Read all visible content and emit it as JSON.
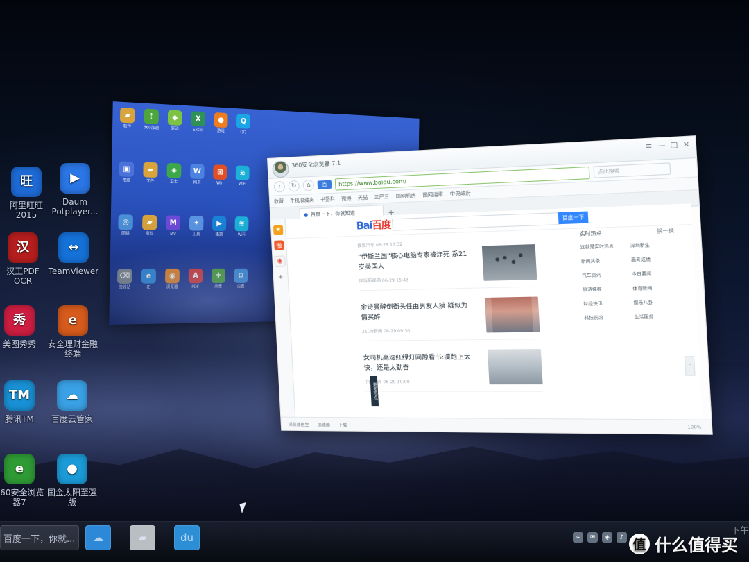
{
  "desktop": {
    "icons": [
      {
        "label": "阿里旺旺2015",
        "icon": "aliwangwang-icon",
        "color": "#1e6bd7"
      },
      {
        "label": "Daum Potplayer...",
        "icon": "play-icon",
        "color": "#2a76e6"
      },
      {
        "label": "汉王PDF OCR",
        "icon": "pdf-ocr-icon",
        "color": "#b71e1e"
      },
      {
        "label": "TeamViewer",
        "icon": "teamviewer-icon",
        "color": "#1572d9"
      },
      {
        "label": "美图秀秀",
        "icon": "meitu-icon",
        "color": "#cf1e42"
      },
      {
        "label": "安全理财金融终端",
        "icon": "finance-terminal-icon",
        "color": "#d75b1c"
      },
      {
        "label": "腾讯TM",
        "icon": "tencent-tm-icon",
        "color": "#1991d6"
      },
      {
        "label": "百度云管家",
        "icon": "baidu-cloud-icon",
        "color": "#3aa1e6"
      },
      {
        "label": "360安全浏览器7",
        "icon": "browser-icon",
        "color": "#2f9b35"
      },
      {
        "label": "国金太阳至强版",
        "icon": "sun-trade-icon",
        "color": "#1b9bd7"
      }
    ],
    "cursor": "mouse-cursor-icon"
  },
  "preview_window": {
    "mini_icons": [
      {
        "label": "软件",
        "icon": "folder-icon",
        "color": "#d9a43b"
      },
      {
        "label": "360加速",
        "icon": "speed-icon",
        "color": "#4da53c"
      },
      {
        "label": "驱动",
        "icon": "driver-icon",
        "color": "#7dc243"
      },
      {
        "label": "Excel",
        "icon": "excel-icon",
        "color": "#2f9155"
      },
      {
        "label": "游戏",
        "icon": "game-icon",
        "color": "#ef7c1f"
      },
      {
        "label": "QQ",
        "icon": "qq-icon",
        "color": "#1aa6e6"
      },
      {
        "label": "电脑",
        "icon": "computer-icon",
        "color": "#4a72d9"
      },
      {
        "label": "文件",
        "icon": "folder-icon",
        "color": "#d9a43b"
      },
      {
        "label": "卫士",
        "icon": "shield-icon",
        "color": "#3ca84a"
      },
      {
        "label": "网页",
        "icon": "web-icon",
        "color": "#4c82e0"
      },
      {
        "label": "Win",
        "icon": "windows-icon",
        "color": "#e34f25"
      },
      {
        "label": "WiFi",
        "icon": "wifi-icon",
        "color": "#1cb1d9"
      },
      {
        "label": "网络",
        "icon": "network-icon",
        "color": "#4b90d7"
      },
      {
        "label": "资料",
        "icon": "folder-icon",
        "color": "#d9a43b"
      },
      {
        "label": "MV",
        "icon": "video-icon",
        "color": "#6d4bd9"
      },
      {
        "label": "工具",
        "icon": "tool-icon",
        "color": "#5a95e3"
      },
      {
        "label": "播放",
        "icon": "play-icon",
        "color": "#1982d8"
      },
      {
        "label": "WiFi",
        "icon": "wifi-icon",
        "color": "#1cb1d9"
      },
      {
        "label": "回收站",
        "icon": "recycle-icon",
        "color": "#7f8c96"
      },
      {
        "label": "IE",
        "icon": "ie-icon",
        "color": "#2e8cde"
      },
      {
        "label": "浏览器",
        "icon": "browser-icon",
        "color": "#e6892a"
      },
      {
        "label": "PDF",
        "icon": "pdf-icon",
        "color": "#d93b3b"
      },
      {
        "label": "杀毒",
        "icon": "antivirus-icon",
        "color": "#4da53c"
      },
      {
        "label": "设置",
        "icon": "settings-icon",
        "color": "#3d92df"
      }
    ]
  },
  "browser": {
    "title": "360安全浏览器 7.1",
    "url": "https://www.baidu.com/",
    "search_placeholder": "点此搜索",
    "bookmarks": [
      "收藏",
      "手机收藏夹",
      "书签栏",
      "微博",
      "天猫",
      "三严三",
      "国网机房",
      "国网运维",
      "中央政府"
    ],
    "tab_label": "百度一下，你就知道",
    "logo_primary": "Bai",
    "logo_secondary": "百度",
    "search_button": "百度一下",
    "news": [
      {
        "source": "搜狐汽车 06-29 17:32",
        "title": "“伊斯兰国”核心电脑专家被炸死 系21岁英国人",
        "meta": "国际新闻网 06-29 15:43"
      },
      {
        "source": "",
        "title": "余诗曼醉倒街头任由男友人摸 疑似为情买醉",
        "meta": "21CN新闻 06-29 09:30"
      },
      {
        "source": "",
        "title": "女司机高速红绿灯间隙看书:摸跑上太快，还是太勤奋",
        "meta": "中国新闻 06-29 10:00"
      }
    ],
    "hot_title": "实时热点",
    "hot_refresh": "换一换",
    "hot_items": [
      "这就是实时热点",
      "深圳新生",
      "新闻头条",
      "高考成绩",
      "汽车资讯",
      "今日要闻",
      "旅游推荐",
      "体育新闻",
      "财经快讯",
      "娱乐八卦",
      "科技前沿",
      "生活服务"
    ],
    "side_float": "更多热点",
    "status_items": [
      "浏览器医生",
      "加速器",
      "下载",
      "100%"
    ]
  },
  "taskbar": {
    "active_window": "百度一下，你就...",
    "watermark": "什么值得买",
    "clock_partial": "下午"
  }
}
